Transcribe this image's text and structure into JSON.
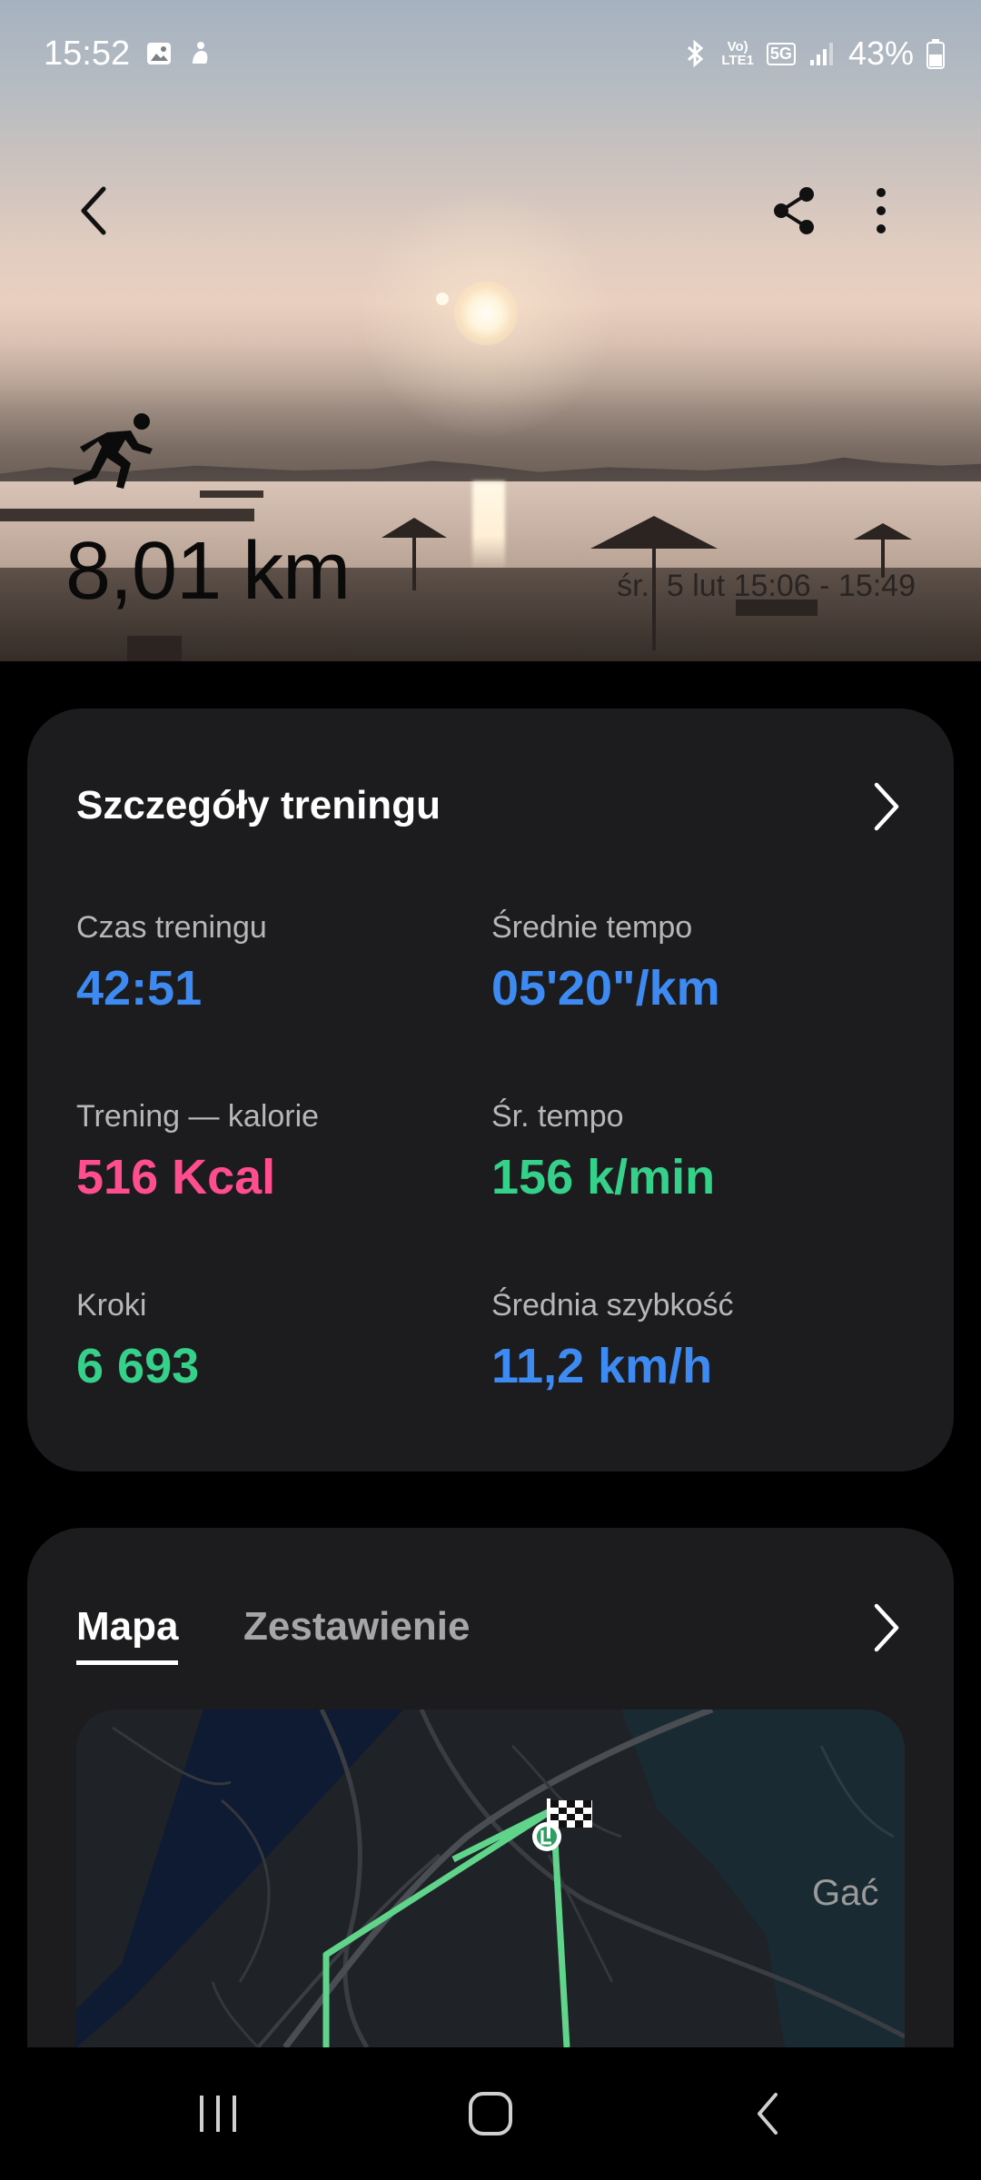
{
  "status_bar": {
    "time": "15:52",
    "battery": "43%",
    "network": "5G",
    "lte_label": "LTE1"
  },
  "hero": {
    "distance": "8,01 km",
    "datetime": "śr., 5 lut 15:06 - 15:49"
  },
  "details": {
    "title": "Szczegóły treningu",
    "metrics": [
      {
        "label": "Czas treningu",
        "value": "42:51",
        "color": "#3d8bf2"
      },
      {
        "label": "Średnie tempo",
        "value": "05'20\"/km",
        "color": "#3d8bf2"
      },
      {
        "label": "Trening — kalorie",
        "value": "516 Kcal",
        "color": "#ff4d8e"
      },
      {
        "label": "Śr. tempo",
        "value": "156 k/min",
        "color": "#35d08a"
      },
      {
        "label": "Kroki",
        "value": "6 693",
        "color": "#35d08a"
      },
      {
        "label": "Średnia szybkość",
        "value": "11,2 km/h",
        "color": "#3d8bf2"
      }
    ]
  },
  "map_card": {
    "tabs": [
      {
        "label": "Mapa",
        "active": true
      },
      {
        "label": "Zestawienie",
        "active": false
      }
    ],
    "map_label": "Gać",
    "route_color": "#5fd48a"
  },
  "icons": {
    "back": "chevron-left-icon",
    "share": "share-icon",
    "more": "more-vertical-icon",
    "runner": "running-icon",
    "finish": "checkered-flag-icon"
  }
}
